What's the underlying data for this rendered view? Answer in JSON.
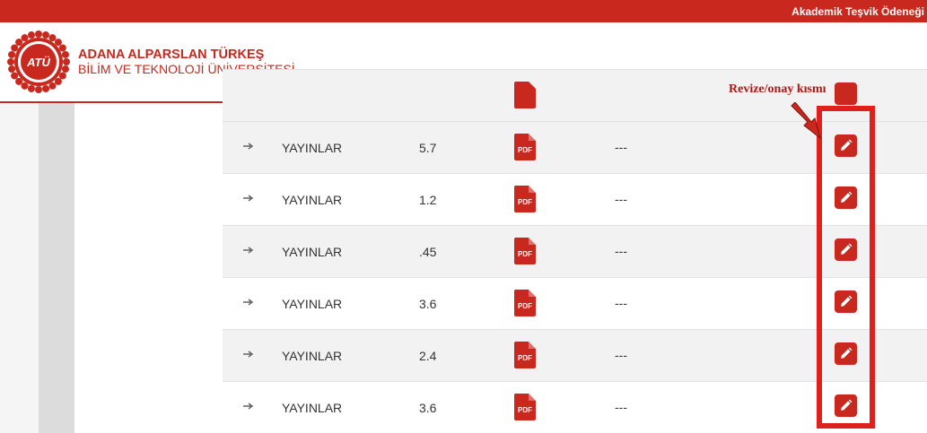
{
  "topbar": {
    "title": "Akademik Teşvik Ödeneği"
  },
  "brand": {
    "logo_text": "ATÜ",
    "name_line1": "ADANA ALPARSLAN TÜRKEŞ",
    "name_line2": "BİLİM VE TEKNOLOJİ ÜNİVERSİTESİ",
    "color": "#c8281e"
  },
  "annotation": {
    "label": "Revize/onay kısmı",
    "color": "#e0201b"
  },
  "table": {
    "rows": [
      {
        "type": "YAYINLAR",
        "score": "5.7",
        "file": "PDF",
        "note": "---"
      },
      {
        "type": "YAYINLAR",
        "score": "1.2",
        "file": "PDF",
        "note": "---"
      },
      {
        "type": "YAYINLAR",
        "score": ".45",
        "file": "PDF",
        "note": "---"
      },
      {
        "type": "YAYINLAR",
        "score": "3.6",
        "file": "PDF",
        "note": "---"
      },
      {
        "type": "YAYINLAR",
        "score": "2.4",
        "file": "PDF",
        "note": "---"
      },
      {
        "type": "YAYINLAR",
        "score": "3.6",
        "file": "PDF",
        "note": "---"
      }
    ],
    "icons": {
      "bullet": "arrow-right-icon",
      "file": "pdf-file-icon",
      "action": "pencil-edit-icon"
    }
  }
}
